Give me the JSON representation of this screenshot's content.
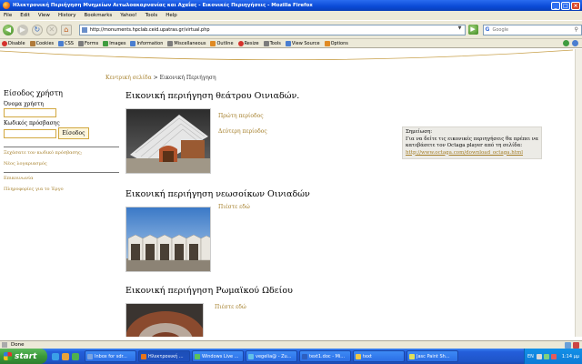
{
  "window": {
    "title": "Ηλεκτρονική Περιήγηση Μνημείων Αιτωλοακαρνανίας και Αχαΐας - Εικονικές Περιηγήσεις - Mozilla Firefox",
    "btn_min": "_",
    "btn_max": "□",
    "btn_close": "×"
  },
  "menu": {
    "items": [
      "File",
      "Edit",
      "View",
      "History",
      "Bookmarks",
      "Yahoo!",
      "Tools",
      "Help"
    ]
  },
  "nav": {
    "url": "http://monuments.hpclab.ceid.upatras.gr/virtual.php",
    "search_placeholder": "Google",
    "search_logo": "G",
    "go": "▶",
    "back": "◀",
    "forward": "▶",
    "reload": "↻",
    "stop": "✕",
    "home": "⌂"
  },
  "devtoolbar": {
    "items": [
      "Disable",
      "Cookies",
      "CSS",
      "Forms",
      "Images",
      "Information",
      "Miscellaneous",
      "Outline",
      "Resize",
      "Tools",
      "View Source",
      "Options"
    ]
  },
  "page": {
    "breadcrumb_home": "Κεντρική σελίδα",
    "breadcrumb_sep": " > ",
    "breadcrumb_current": "Εικονική Περιήγηση",
    "login": {
      "title": "Είσοδος χρήστη",
      "username_label": "Όνομα χρήστη",
      "password_label": "Κωδικός πρόσβασης",
      "submit": "Είσοδος"
    },
    "side_links": [
      "Ξεχάσατε τον κωδικό πρόσβασης;",
      "Νέος λογαριασμός",
      "Επικοινωνία",
      "Πληροφορίες για το Έργο"
    ],
    "sections": [
      {
        "title": "Εικονική περιήγηση θεάτρου Οινιαδών.",
        "links": [
          "Πρώτη περίοδος",
          "Δεύτερη περίοδος"
        ]
      },
      {
        "title": "Εικονική περιήγηση νεωσοίκων Οινιαδών",
        "links": [
          "Πιέστε εδώ"
        ]
      },
      {
        "title": "Εικονική περιήγηση Ρωμαϊκού Ωδείου",
        "links": [
          "Πιέστε εδώ"
        ]
      }
    ],
    "note": {
      "heading": "Σημείωση:",
      "body": "Για να δείτε τις εικονικές περιηγήσεις θα πρέπει να κατεβάσετε τον Octaga player από τη σελίδα:",
      "link": "http://www.octaga.com/download_octaga.html"
    }
  },
  "status": {
    "text": "Done"
  },
  "taskbar": {
    "start": "start",
    "tasks": [
      "Inbox for sdr...",
      "Ηλεκτρονική ...",
      "Windows Live ...",
      "vegelia@ - Zu...",
      "text1.doc - Mi...",
      "text",
      "Jasc Paint Sh..."
    ],
    "lang": "EN",
    "clock": "1:14 μμ"
  },
  "colors": {
    "link": "#a57f2a",
    "field_border": "#d2a840",
    "note_bg": "#ecebe6"
  }
}
